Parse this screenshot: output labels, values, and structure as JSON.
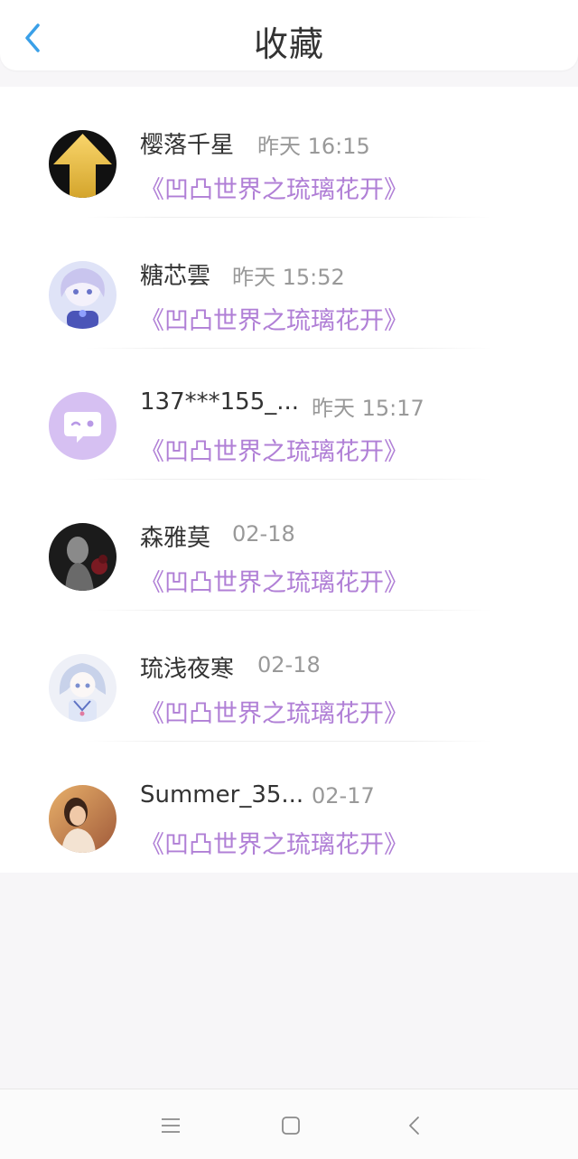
{
  "header": {
    "title": "收藏",
    "back_icon": "chevron-left-icon",
    "accent_color": "#3aa0e8"
  },
  "favorites": [
    {
      "name": "樱落千星",
      "time": "昨天 16:15",
      "collection": "《凹凸世界之琉璃花开》",
      "avatar": "gold-arrow-avatar"
    },
    {
      "name": "糖芯雲",
      "time": "昨天 15:52",
      "collection": "《凹凸世界之琉璃花开》",
      "avatar": "anime-girl-avatar"
    },
    {
      "name": "137***155_...",
      "time": "昨天 15:17",
      "collection": "《凹凸世界之琉璃花开》",
      "avatar": "default-chat-avatar"
    },
    {
      "name": "森雅莫",
      "time": "02-18",
      "collection": "《凹凸世界之琉璃花开》",
      "avatar": "dark-portrait-avatar"
    },
    {
      "name": "琉浅夜寒",
      "time": "02-18",
      "collection": "《凹凸世界之琉璃花开》",
      "avatar": "anime-girl-blue-avatar"
    },
    {
      "name": "Summer_35...",
      "time": "02-17",
      "collection": "《凹凸世界之琉璃花开》",
      "avatar": "photo-girl-avatar"
    }
  ],
  "colors": {
    "collection_text": "#b07fd6",
    "time_text": "#999999",
    "name_text": "#333333"
  },
  "navbar": {
    "menu_icon": "menu-icon",
    "home_icon": "square-home-icon",
    "back_icon": "triangle-back-icon"
  }
}
